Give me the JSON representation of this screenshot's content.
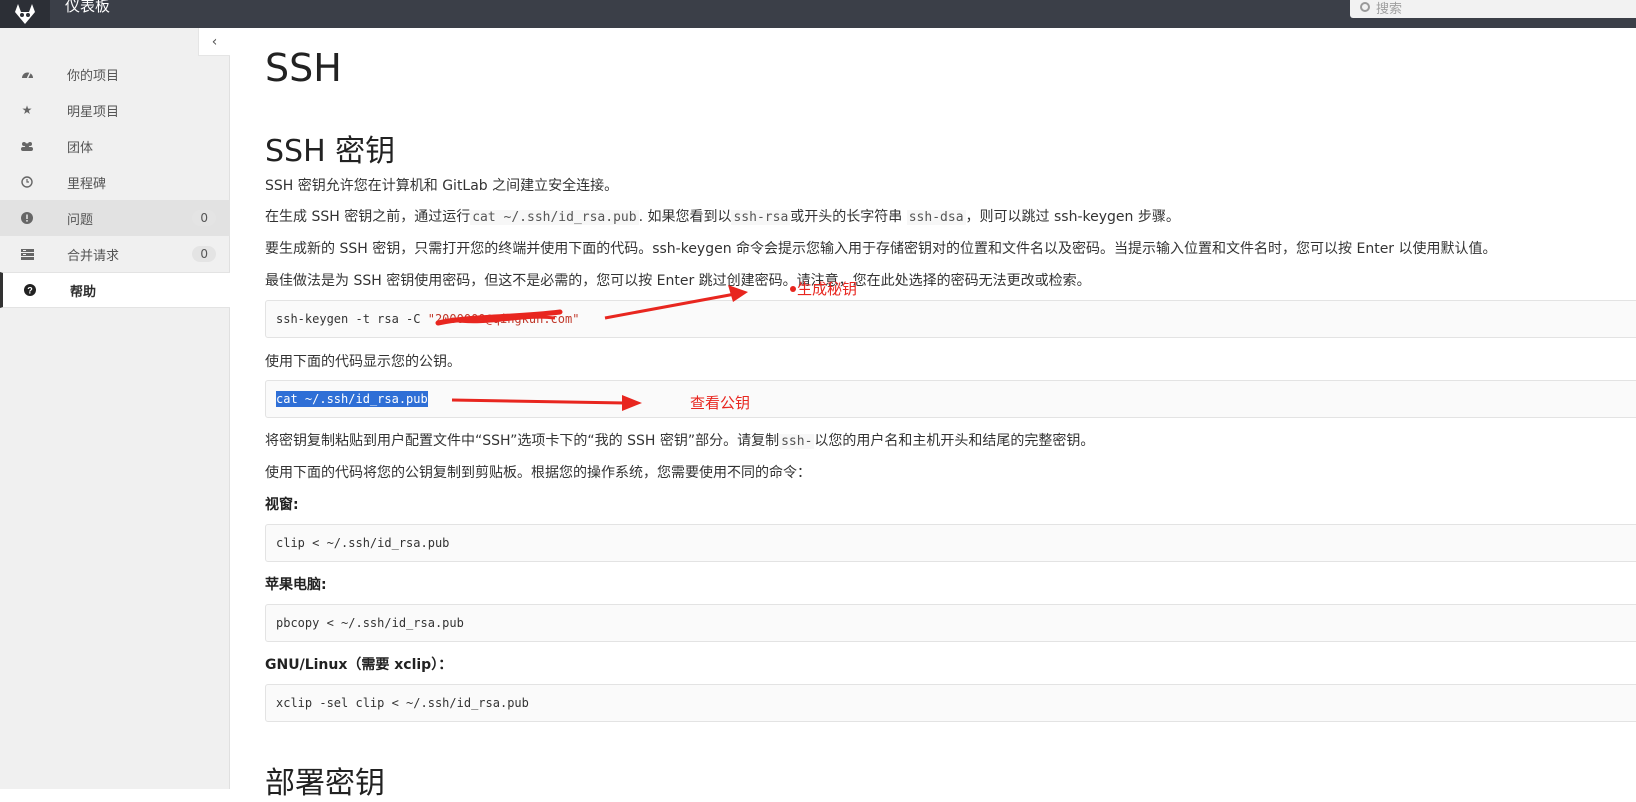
{
  "header": {
    "app_title": "仪表板",
    "search_placeholder": "搜索"
  },
  "sidebar": {
    "items": [
      {
        "label": "你的项目",
        "icon": "dashboard-icon"
      },
      {
        "label": "明星项目",
        "icon": "star-icon"
      },
      {
        "label": "团体",
        "icon": "users-icon"
      },
      {
        "label": "里程碑",
        "icon": "clock-icon"
      },
      {
        "label": "问题",
        "icon": "exclamation-circle-icon",
        "count": "0"
      },
      {
        "label": "合并请求",
        "icon": "merge-list-icon",
        "count": "0"
      },
      {
        "label": "帮助",
        "icon": "question-circle-icon"
      }
    ]
  },
  "main": {
    "title": "SSH",
    "section_title": "SSH 密钥",
    "p1": "SSH 密钥允许您在计算机和 GitLab 之间建立安全连接。",
    "p2a": "在生成 SSH 密钥之前，通过运行",
    "p2_code1": "cat ~/.ssh/id_rsa.pub",
    "p2b": ". 如果您看到以",
    "p2_code2": "ssh-rsa",
    "p2c": "或开头的长字符串 ",
    "p2_code3": "ssh-dsa",
    "p2d": "，则可以跳过 ssh-keygen 步骤。",
    "p3": "要生成新的 SSH 密钥，只需打开您的终端并使用下面的代码。ssh-keygen 命令会提示您输入用于存储密钥对的位置和文件名以及密码。当提示输入位置和文件名时，您可以按 Enter 以使用默认值。",
    "p4": "最佳做法是为 SSH 密钥使用密码，但这不是必需的，您可以按 Enter 跳过创建密码。请注意，您在此处选择的密码无法更改或检索。",
    "code_keygen_cmd": "ssh-keygen -t rsa -C ",
    "code_keygen_str": "\"2000000@qingkun.com\"",
    "p5": "使用下面的代码显示您的公钥。",
    "code_cat": "cat ~/.ssh/id_rsa.pub",
    "p6a": "将密钥复制粘贴到用户配置文件中“SSH”选项卡下的“我的 SSH 密钥”部分。请复制",
    "p6_code": "ssh-",
    "p6b": "以您的用户名和主机开头和结尾的完整密钥。",
    "p7": "使用下面的代码将您的公钥复制到剪贴板。根据您的操作系统，您需要使用不同的命令：",
    "windows_label": "视窗:",
    "code_windows": "clip < ~/.ssh/id_rsa.pub",
    "mac_label": "苹果电脑:",
    "code_mac": "pbcopy < ~/.ssh/id_rsa.pub",
    "linux_label": "GNU/Linux（需要 xclip）：",
    "code_linux": "xclip -sel clip < ~/.ssh/id_rsa.pub",
    "deploy_title": "部署密钥"
  },
  "annotations": {
    "generate_key": "生成秘钥",
    "view_pubkey": "查看公钥",
    "color": "#e8261f"
  }
}
